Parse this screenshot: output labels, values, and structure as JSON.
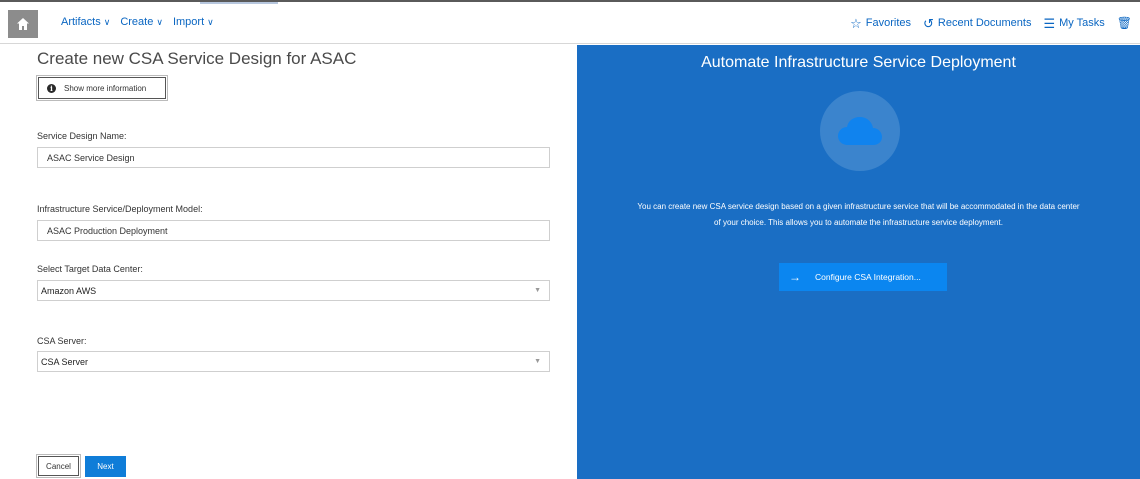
{
  "topbar": {
    "nav": [
      {
        "label": "Artifacts",
        "icon": "chevron-down-icon"
      },
      {
        "label": "Create",
        "icon": "chevron-down-icon"
      },
      {
        "label": "Import",
        "icon": "chevron-down-icon"
      }
    ],
    "right": {
      "favorites": "Favorites",
      "recent": "Recent Documents",
      "tasks": "My Tasks"
    },
    "icons": {
      "home": "home-icon",
      "favorites": "star-icon",
      "recent": "history-icon",
      "tasks": "tasks-icon",
      "trash": "trash-icon"
    }
  },
  "form": {
    "title": "Create new CSA Service Design for ASAC",
    "info_button": "Show more information",
    "service_design_name": {
      "label": "Service Design Name:",
      "value": "ASAC Service Design"
    },
    "infrastructure_model": {
      "label": "Infrastructure Service/Deployment Model:",
      "value": "ASAC Production Deployment"
    },
    "data_center": {
      "label": "Select Target Data Center:",
      "value": "Amazon AWS"
    },
    "csa_server": {
      "label": "CSA Server:",
      "value": "CSA Server"
    },
    "cancel_label": "Cancel",
    "next_label": "Next"
  },
  "info_panel": {
    "title": "Automate Infrastructure Service Deployment",
    "description": "You can create new CSA service design based on a given infrastructure service that will be accommodated in the data center of your choice. This allows you to automate the infrastructure service deployment.",
    "button_label": "Configure CSA Integration..."
  },
  "colors": {
    "accent": "#0a66c2",
    "panel_bg": "#1a6ec4",
    "primary_button": "#0f7dd8",
    "configure_button": "#0b86f0"
  }
}
